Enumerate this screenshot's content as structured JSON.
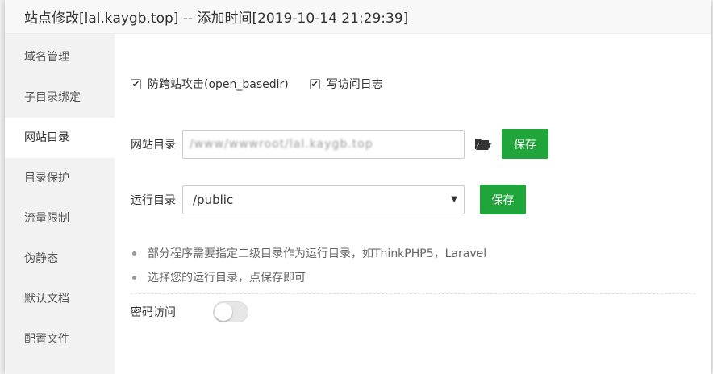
{
  "modal": {
    "title": "站点修改[lal.kaygb.top] -- 添加时间[2019-10-14 21:29:39]"
  },
  "sidebar": {
    "items": [
      {
        "label": "域名管理",
        "active": false
      },
      {
        "label": "子目录绑定",
        "active": false
      },
      {
        "label": "网站目录",
        "active": true
      },
      {
        "label": "目录保护",
        "active": false
      },
      {
        "label": "流量限制",
        "active": false
      },
      {
        "label": "伪静态",
        "active": false
      },
      {
        "label": "默认文档",
        "active": false
      },
      {
        "label": "配置文件",
        "active": false
      }
    ]
  },
  "options": {
    "open_basedir_label": "防跨站攻击(open_basedir)",
    "open_basedir_checked": true,
    "access_log_label": "写访问日志",
    "access_log_checked": true
  },
  "site_dir": {
    "label": "网站目录",
    "value": "/www/wwwroot/lal.kaygb.top",
    "icon": "folder-open-icon",
    "save_label": "保存"
  },
  "run_dir": {
    "label": "运行目录",
    "selected": "/public",
    "save_label": "保存"
  },
  "tips": [
    "部分程序需要指定二级目录作为运行目录，如ThinkPHP5，Laravel",
    "选择您的运行目录，点保存即可"
  ],
  "password_access": {
    "label": "密码访问",
    "enabled": false
  },
  "colors": {
    "accent": "#20a53a",
    "sidebar_bg": "#f2f2f2",
    "header_bg": "#f8f8f8"
  }
}
